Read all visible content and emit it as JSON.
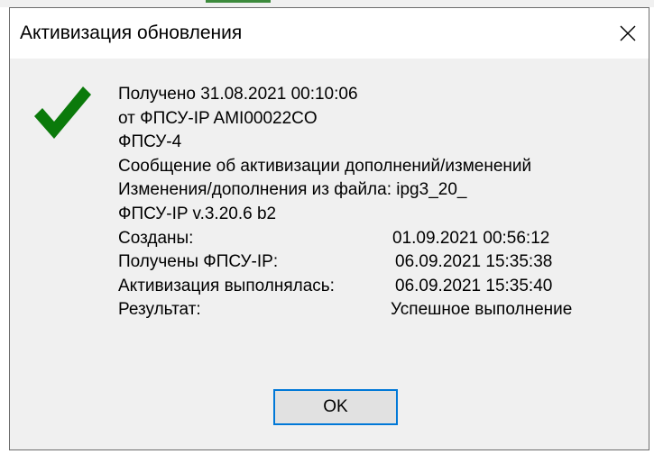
{
  "dialog": {
    "title": "Активизация обновления",
    "ok_label": "OK"
  },
  "message": {
    "received": "Получено 31.08.2021  00:10:06",
    "from": "от ФПСУ-IP  AMI00022CO",
    "device": "ФПСУ-4",
    "subject": "Сообщение об активизации дополнений/изменений",
    "file": "Изменения/дополнения из файла: ipg3_20_",
    "version": "ФПСУ-IP v.3.20.6 b2"
  },
  "details": [
    {
      "label": "Созданы:",
      "value": "01.09.2021  00:56:12"
    },
    {
      "label": "Получены ФПСУ-IP:",
      "value": "06.09.2021  15:35:38"
    },
    {
      "label": "Активизация выполнялась:",
      "value": "06.09.2021  15:35:40"
    },
    {
      "label": "Результат:",
      "value": "Успешное выполнение"
    }
  ],
  "icons": {
    "status": "checkmark-icon",
    "close": "close-icon"
  },
  "colors": {
    "check_green": "#0b7a0b",
    "focus_border": "#0078d7",
    "dialog_bg": "#f0f0f0"
  }
}
